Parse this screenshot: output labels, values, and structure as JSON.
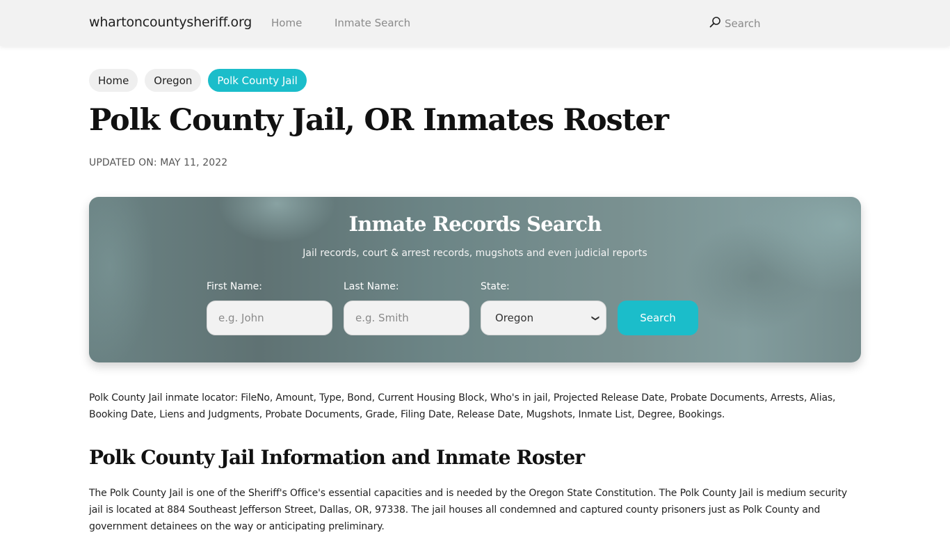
{
  "navbar": {
    "brand": "whartoncountysheriff.org",
    "links": [
      {
        "label": "Home"
      },
      {
        "label": "Inmate Search"
      }
    ],
    "search_label": "Search",
    "search_icon": "search-icon"
  },
  "breadcrumb": [
    {
      "label": "Home",
      "active": false
    },
    {
      "label": "Oregon",
      "active": false
    },
    {
      "label": "Polk County Jail",
      "active": true
    }
  ],
  "page": {
    "title": "Polk County Jail, OR Inmates Roster",
    "updated": "UPDATED ON: MAY 11, 2022"
  },
  "search_card": {
    "title": "Inmate Records Search",
    "subtitle": "Jail records, court & arrest records, mugshots and even judicial reports",
    "first_name_label": "First Name:",
    "first_name_placeholder": "e.g. John",
    "first_name_value": "",
    "last_name_label": "Last Name:",
    "last_name_placeholder": "e.g. Smith",
    "last_name_value": "",
    "state_label": "State:",
    "state_selected": "Oregon",
    "button_label": "Search"
  },
  "content": {
    "locator_text": "Polk County Jail inmate locator: FileNo, Amount, Type, Bond, Current Housing Block, Who's in jail, Projected Release Date, Probate Documents, Arrests, Alias, Booking Date, Liens and Judgments, Probate Documents, Grade, Filing Date, Release Date, Mugshots, Inmate List, Degree, Bookings.",
    "section_title": "Polk County Jail Information and Inmate Roster",
    "info_text": "The Polk County Jail is one of the Sheriff's Office's essential capacities and is needed by the Oregon State Constitution. The Polk County Jail is medium security jail is located at 884 Southeast Jefferson Street, Dallas, OR, 97338. The jail houses all condemned and captured county prisoners just as Polk County and government detainees on the way or anticipating preliminary."
  },
  "colors": {
    "accent": "#1bbdca",
    "navbar_bg": "#f2f2f2",
    "card_bg": "#6b8384"
  }
}
